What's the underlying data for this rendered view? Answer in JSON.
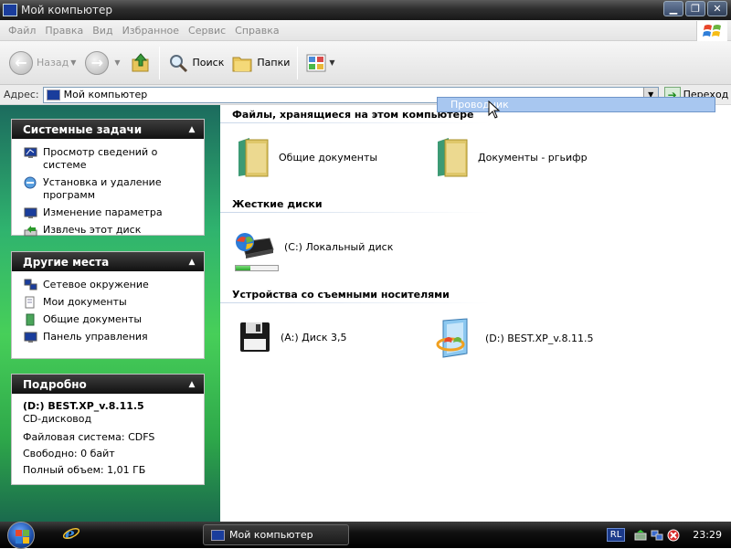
{
  "window": {
    "title": "Мой компьютер"
  },
  "menu": [
    "Файл",
    "Правка",
    "Вид",
    "Избранное",
    "Сервис",
    "Справка"
  ],
  "toolbar": {
    "back": "Назад",
    "search": "Поиск",
    "folders": "Папки"
  },
  "address": {
    "label": "Адрес:",
    "value": "Мой компьютер",
    "go": "Переход"
  },
  "tooltip": "Проводник",
  "sidebar": {
    "system_tasks": {
      "title": "Системные задачи",
      "items": [
        "Просмотр сведений о системе",
        "Установка и удаление программ",
        "Изменение параметра",
        "Извлечь этот диск"
      ]
    },
    "other_places": {
      "title": "Другие места",
      "items": [
        "Сетевое окружение",
        "Мои документы",
        "Общие документы",
        "Панель управления"
      ]
    },
    "details": {
      "title": "Подробно",
      "name": "(D:) BEST.XP_v.8.11.5",
      "type": "CD-дисковод",
      "fs": "Файловая система: CDFS",
      "free": "Свободно: 0 байт",
      "total": "Полный объем: 1,01 ГБ"
    }
  },
  "content": {
    "files_group": "Файлы, хранящиеся на этом компьютере",
    "shared_docs": "Общие документы",
    "user_docs": "Документы - ргьифр",
    "hdd_group": "Жесткие диски",
    "drive_c": "(C:) Локальный диск",
    "drive_c_usage": 0.35,
    "removable_group": "Устройства со съемными носителями",
    "drive_a": "(A:) Диск 3,5",
    "drive_d": "(D:) BEST.XP_v.8.11.5"
  },
  "taskbar": {
    "task": "Мой компьютер",
    "lang": "RL",
    "clock": "23:29"
  }
}
